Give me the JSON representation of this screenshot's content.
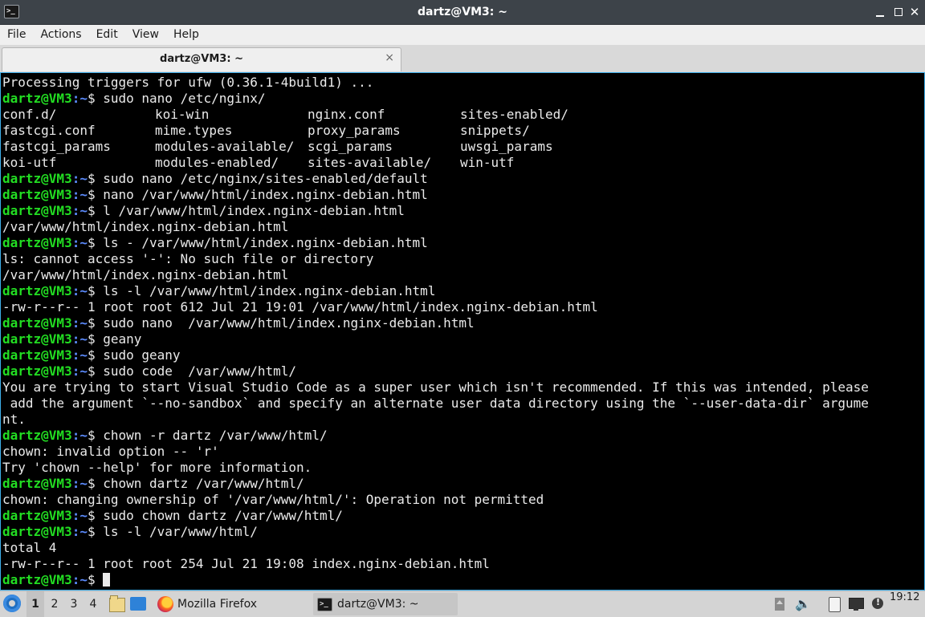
{
  "window": {
    "title": "dartz@VM3: ~",
    "menu": [
      "File",
      "Actions",
      "Edit",
      "View",
      "Help"
    ],
    "tab_label": "dartz@VM3: ~",
    "tab_close": "×",
    "close_glyph": "✕"
  },
  "terminal": {
    "prompt_user": "dartz@VM3",
    "prompt_path": ":~",
    "lines": [
      {
        "type": "out",
        "text": "Processing triggers for ufw (0.36.1-4build1) ..."
      },
      {
        "type": "prompt",
        "cmd": "$ sudo nano /etc/nginx/"
      },
      {
        "type": "ls",
        "cells": [
          "conf.d/",
          "koi-win",
          "nginx.conf",
          "sites-enabled/"
        ]
      },
      {
        "type": "ls",
        "cells": [
          "fastcgi.conf",
          "mime.types",
          "proxy_params",
          "snippets/"
        ]
      },
      {
        "type": "ls",
        "cells": [
          "fastcgi_params",
          "modules-available/",
          "scgi_params",
          "uwsgi_params"
        ]
      },
      {
        "type": "ls",
        "cells": [
          "koi-utf",
          "modules-enabled/",
          "sites-available/",
          "win-utf"
        ]
      },
      {
        "type": "prompt",
        "cmd": "$ sudo nano /etc/nginx/sites-enabled/default"
      },
      {
        "type": "prompt",
        "cmd": "$ nano /var/www/html/index.nginx-debian.html"
      },
      {
        "type": "prompt",
        "cmd": "$ l /var/www/html/index.nginx-debian.html"
      },
      {
        "type": "out",
        "text": "/var/www/html/index.nginx-debian.html"
      },
      {
        "type": "prompt",
        "cmd": "$ ls - /var/www/html/index.nginx-debian.html"
      },
      {
        "type": "out",
        "text": "ls: cannot access '-': No such file or directory"
      },
      {
        "type": "out",
        "text": "/var/www/html/index.nginx-debian.html"
      },
      {
        "type": "prompt",
        "cmd": "$ ls -l /var/www/html/index.nginx-debian.html"
      },
      {
        "type": "out",
        "text": "-rw-r--r-- 1 root root 612 Jul 21 19:01 /var/www/html/index.nginx-debian.html"
      },
      {
        "type": "prompt",
        "cmd": "$ sudo nano  /var/www/html/index.nginx-debian.html"
      },
      {
        "type": "prompt",
        "cmd": "$ geany"
      },
      {
        "type": "prompt",
        "cmd": "$ sudo geany"
      },
      {
        "type": "prompt",
        "cmd": "$ sudo code  /var/www/html/"
      },
      {
        "type": "out",
        "text": "You are trying to start Visual Studio Code as a super user which isn't recommended. If this was intended, please"
      },
      {
        "type": "out",
        "text": " add the argument `--no-sandbox` and specify an alternate user data directory using the `--user-data-dir` argume"
      },
      {
        "type": "out",
        "text": "nt."
      },
      {
        "type": "prompt",
        "cmd": "$ chown -r dartz /var/www/html/"
      },
      {
        "type": "out",
        "text": "chown: invalid option -- 'r'"
      },
      {
        "type": "out",
        "text": "Try 'chown --help' for more information."
      },
      {
        "type": "prompt",
        "cmd": "$ chown dartz /var/www/html/"
      },
      {
        "type": "out",
        "text": "chown: changing ownership of '/var/www/html/': Operation not permitted"
      },
      {
        "type": "prompt",
        "cmd": "$ sudo chown dartz /var/www/html/"
      },
      {
        "type": "prompt",
        "cmd": "$ ls -l /var/www/html/"
      },
      {
        "type": "out",
        "text": "total 4"
      },
      {
        "type": "out",
        "text": "-rw-r--r-- 1 root root 254 Jul 21 19:08 index.nginx-debian.html"
      },
      {
        "type": "prompt_cursor",
        "cmd": "$ "
      }
    ]
  },
  "taskbar": {
    "workspaces": [
      "1",
      "2",
      "3",
      "4"
    ],
    "active_workspace": "1",
    "tasks": [
      {
        "label": "Mozilla Firefox",
        "icon": "firefox-icon"
      },
      {
        "label": "dartz@VM3: ~",
        "icon": "terminal-icon"
      }
    ],
    "tray_icons": [
      "show-hidden-icon",
      "volume-icon",
      "clipboard-icon",
      "network-icon",
      "notification-icon"
    ],
    "volume_glyph": "🔈",
    "clock": "19:12"
  },
  "colors": {
    "prompt_user": "#22dd22",
    "prompt_path": "#5c8cff",
    "terminal_bg": "#000000",
    "accent_border": "#3daee9",
    "titlebar_bg": "#3d4349"
  }
}
